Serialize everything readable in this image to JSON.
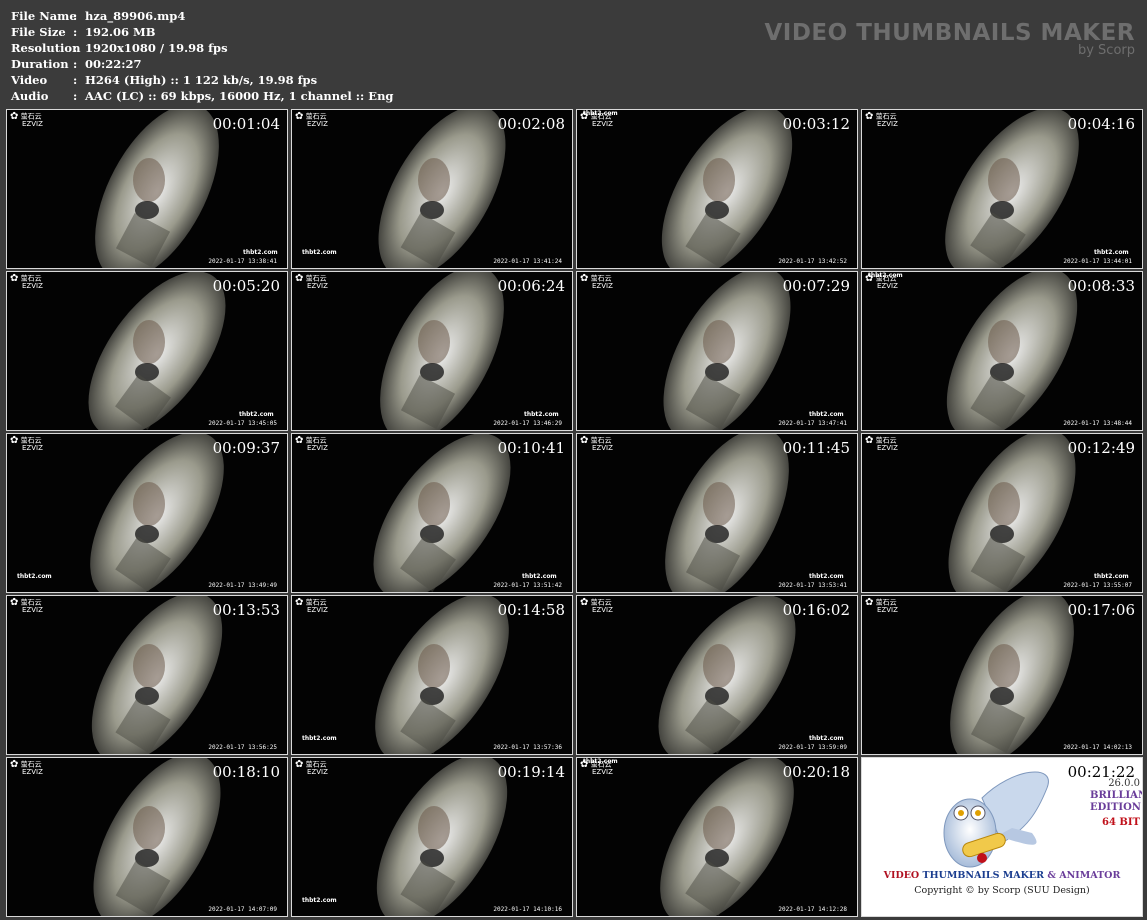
{
  "info": [
    {
      "label": "File Name",
      "value": "hza_89906.mp4"
    },
    {
      "label": "File Size",
      "value": "192.06 MB"
    },
    {
      "label": "Resolution",
      "value": "1920x1080 / 19.98 fps"
    },
    {
      "label": "Duration",
      "value": "00:22:27"
    },
    {
      "label": "Video",
      "value": "H264 (High) :: 1 122 kb/s, 19.98 fps"
    },
    {
      "label": "Audio",
      "value": "AAC (LC) :: 69 kbps, 16000 Hz, 1 channel :: Eng"
    }
  ],
  "separator": ":",
  "brand": {
    "title": "VIDEO THUMBNAILS MAKER",
    "byline": "by Scorp"
  },
  "cam_logo": {
    "cn": "萤石云",
    "en": "EZVIZ"
  },
  "watermark": "thbt2.com",
  "thumbs": [
    {
      "time": "00:01:04",
      "stamp": "2022-01-17 13:38:41"
    },
    {
      "time": "00:02:08",
      "stamp": "2022-01-17 13:41:24"
    },
    {
      "time": "00:03:12",
      "stamp": "2022-01-17 13:42:52"
    },
    {
      "time": "00:04:16",
      "stamp": "2022-01-17 13:44:01"
    },
    {
      "time": "00:05:20",
      "stamp": "2022-01-17 13:45:05"
    },
    {
      "time": "00:06:24",
      "stamp": "2022-01-17 13:46:29"
    },
    {
      "time": "00:07:29",
      "stamp": "2022-01-17 13:47:41"
    },
    {
      "time": "00:08:33",
      "stamp": "2022-01-17 13:48:44"
    },
    {
      "time": "00:09:37",
      "stamp": "2022-01-17 13:49:49"
    },
    {
      "time": "00:10:41",
      "stamp": "2022-01-17 13:51:42"
    },
    {
      "time": "00:11:45",
      "stamp": "2022-01-17 13:53:41"
    },
    {
      "time": "00:12:49",
      "stamp": "2022-01-17 13:55:07"
    },
    {
      "time": "00:13:53",
      "stamp": "2022-01-17 13:56:25"
    },
    {
      "time": "00:14:58",
      "stamp": "2022-01-17 13:57:36"
    },
    {
      "time": "00:16:02",
      "stamp": "2022-01-17 13:59:09"
    },
    {
      "time": "00:17:06",
      "stamp": "2022-01-17 14:02:13"
    },
    {
      "time": "00:18:10",
      "stamp": "2022-01-17 14:07:09"
    },
    {
      "time": "00:19:14",
      "stamp": "2022-01-17 14:10:16"
    },
    {
      "time": "00:20:18",
      "stamp": "2022-01-17 14:12:28"
    }
  ],
  "ad": {
    "time": "00:21:22",
    "version": "26.0.0",
    "edition": "BRILLIANCE EDITION",
    "bits": "64 BIT",
    "product_a": "VIDEO",
    "product_b": "THUMBNAILS MAKER",
    "product_c": "& ANIMATOR",
    "copyright": "Copyright © by Scorp (SUU Design)"
  }
}
